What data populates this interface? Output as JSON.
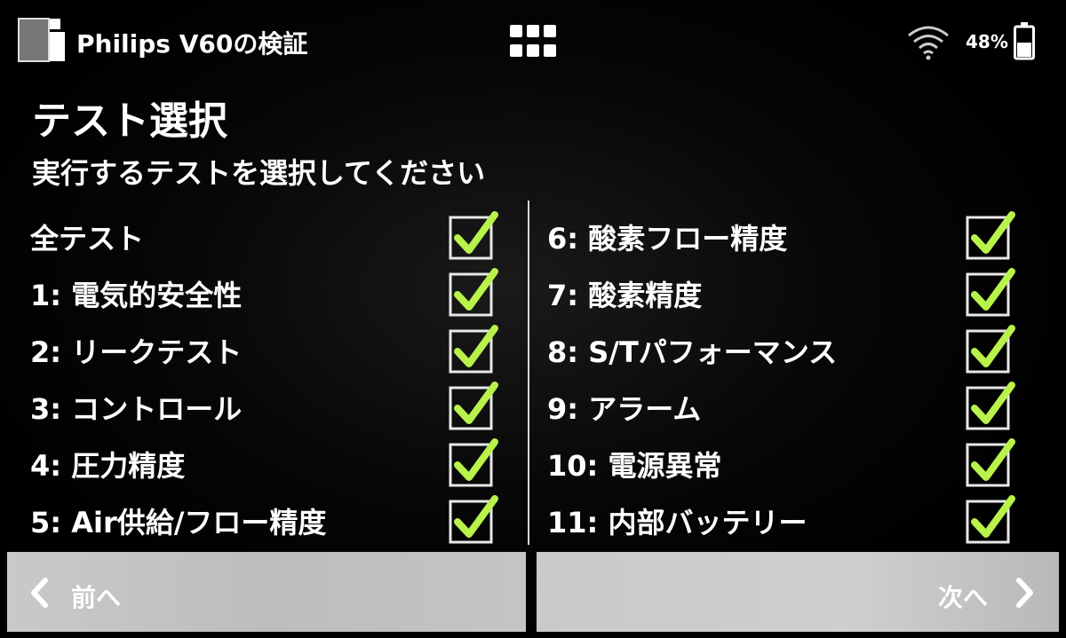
{
  "header": {
    "app_title": "Philips V60の検証",
    "battery_percent": "48%",
    "battery_level": 0.48,
    "wifi_icon": "wifi-icon",
    "menu_icon": "grid-menu-icon"
  },
  "page": {
    "title": "テスト選択",
    "instruction": "実行するテストを選択してください"
  },
  "tests_left": [
    {
      "label": "全テスト",
      "checked": true
    },
    {
      "label": "1: 電気的安全性",
      "checked": true
    },
    {
      "label": "2: リークテスト",
      "checked": true
    },
    {
      "label": "3: コントロール",
      "checked": true
    },
    {
      "label": "4: 圧力精度",
      "checked": true
    },
    {
      "label": "5: Air供給/フロー精度",
      "checked": true
    }
  ],
  "tests_right": [
    {
      "label": "6: 酸素フロー精度",
      "checked": true
    },
    {
      "label": "7: 酸素精度",
      "checked": true
    },
    {
      "label": "8: S/Tパフォーマンス",
      "checked": true
    },
    {
      "label": "9: アラーム",
      "checked": true
    },
    {
      "label": "10: 電源異常",
      "checked": true
    },
    {
      "label": "11: 内部バッテリー",
      "checked": true
    }
  ],
  "footer": {
    "prev_label": "前へ",
    "next_label": "次へ"
  },
  "colors": {
    "check": "#b8f24a",
    "box_border": "#e8e8e8",
    "button_bg": "#c6c6c6"
  }
}
